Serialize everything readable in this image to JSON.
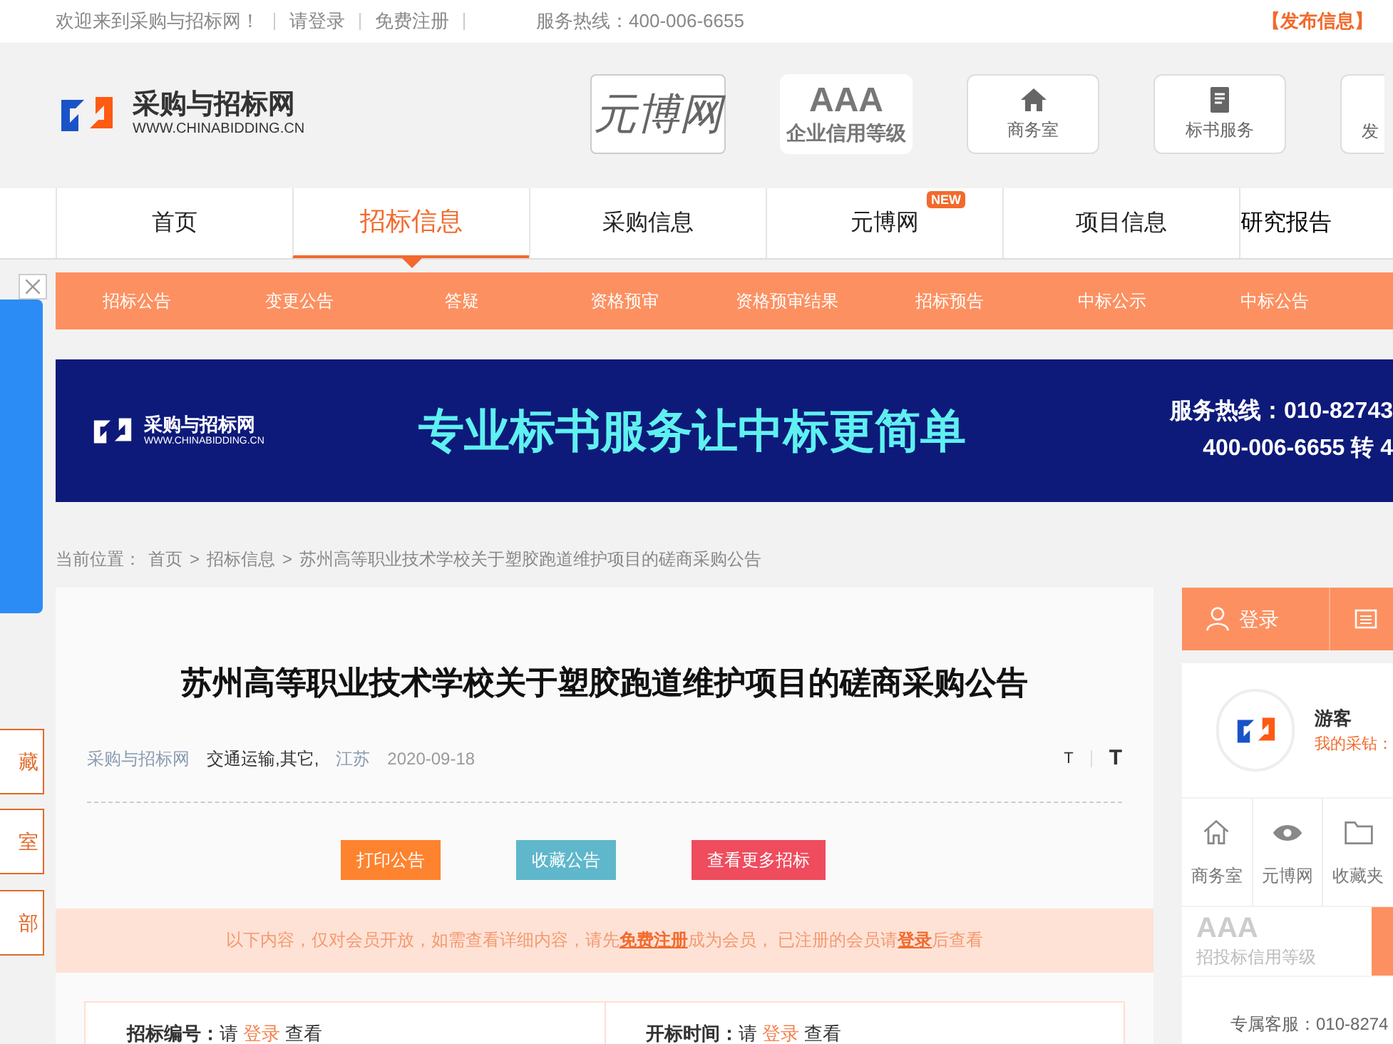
{
  "top_bar": {
    "welcome": "欢迎来到采购与招标网！",
    "links": [
      "请登录",
      "免费注册"
    ],
    "hotline": "服务热线：400-006-6655",
    "publish": "【发布信息】"
  },
  "header": {
    "logo_name": "采购与招标网",
    "logo_url": "WWW.CHINABIDDING.CN",
    "tiles": [
      {
        "kind": "brand",
        "label": "元博网"
      },
      {
        "kind": "rating",
        "big": "AAA",
        "label": "企业信用等级"
      },
      {
        "kind": "home",
        "label": "商务室"
      },
      {
        "kind": "doc",
        "label": "标书服务"
      },
      {
        "kind": "cut",
        "label": "发"
      }
    ]
  },
  "nav": [
    {
      "label": "首页",
      "selected": false
    },
    {
      "label": "招标信息",
      "selected": true
    },
    {
      "label": "采购信息",
      "selected": false
    },
    {
      "label": "元博网",
      "selected": false,
      "badge": "NEW"
    },
    {
      "label": "项目信息",
      "selected": false
    },
    {
      "label": "研究报告",
      "selected": false
    }
  ],
  "subnav": [
    "招标公告",
    "变更公告",
    "答疑",
    "资格预审",
    "资格预审结果",
    "招标预告",
    "中标公示",
    "中标公告"
  ],
  "banner": {
    "logo_name": "采购与招标网",
    "logo_url": "WWW.CHINABIDDING.CN",
    "slogan": "专业标书服务让中标更简单",
    "hotline_1": "服务热线：010-82743",
    "hotline_2": "400-006-6655 转 4"
  },
  "side_buttons": [
    "藏",
    "室",
    "部"
  ],
  "breadcrumb": [
    "当前位置：",
    "首页",
    ">",
    "招标信息",
    ">",
    "苏州高等职业技术学校关于塑胶跑道维护项目的磋商采购公告"
  ],
  "article": {
    "title": "苏州高等职业技术学校关于塑胶跑道维护项目的磋商采购公告",
    "meta": {
      "source": "采购与招标网",
      "category": "交通运输,其它,",
      "region": "江苏",
      "date": "2020-09-18",
      "font_small": "T",
      "font_large": "T"
    },
    "buttons": [
      {
        "label": "打印公告",
        "color": "#fe832f"
      },
      {
        "label": "收藏公告",
        "color": "#5fb7cb"
      },
      {
        "label": "查看更多招标",
        "color": "#ef4c5e"
      }
    ],
    "notice": "以下内容，仅对会员开放，如需查看详细内容，请先 **免费注册** 成为会员， 已注册的会员请 **登录** 后查看",
    "fields": [
      {
        "label": "招标编号：",
        "pre": "请",
        "link": "登录",
        "post": "查看"
      },
      {
        "label": "开标时间：",
        "pre": "请",
        "link": "登录",
        "post": "查看"
      }
    ]
  },
  "sidebar": {
    "login": "登录",
    "user": "游客",
    "my": "我的采钻：",
    "shortcuts": [
      {
        "kind": "home",
        "label": "商务室"
      },
      {
        "kind": "eye",
        "label": "元博网"
      },
      {
        "kind": "folder",
        "label": "收藏夹"
      }
    ],
    "rating": "AAA",
    "rating_label": "招投标信用等级",
    "service": "专属客服：010-8274"
  }
}
